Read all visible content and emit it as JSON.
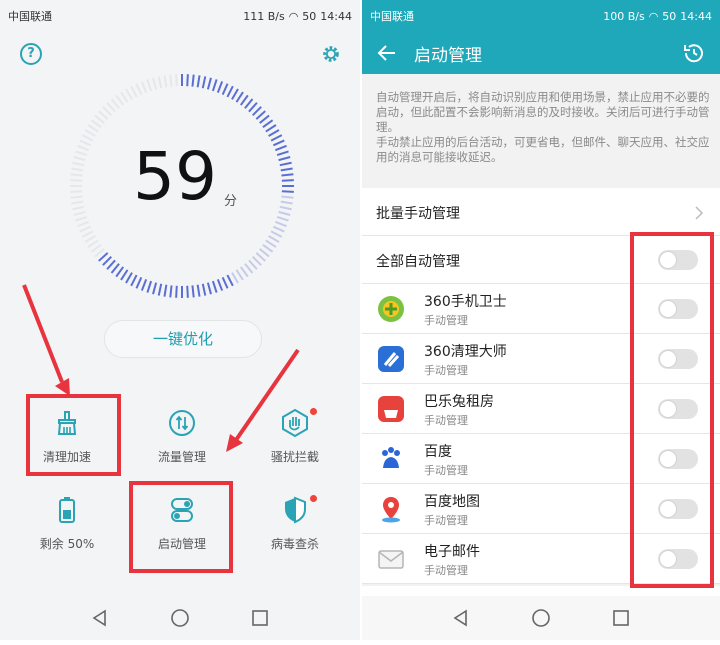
{
  "left": {
    "status": {
      "carrier": "中国联通",
      "speed": "111 B/s",
      "battery": "50",
      "time": "14:44"
    },
    "score": {
      "value": "59",
      "unit": "分"
    },
    "optimize_label": "一键优化",
    "tools": [
      {
        "label": "清理加速",
        "icon": "broom-icon"
      },
      {
        "label": "流量管理",
        "icon": "data-traffic-icon"
      },
      {
        "label": "骚扰拦截",
        "icon": "hand-block-icon",
        "badge": true
      },
      {
        "label": "剩余 50%",
        "icon": "battery-icon"
      },
      {
        "label": "启动管理",
        "icon": "startup-toggle-icon"
      },
      {
        "label": "病毒查杀",
        "icon": "shield-icon",
        "badge": true
      }
    ]
  },
  "right": {
    "status": {
      "carrier": "中国联通",
      "speed": "100 B/s",
      "battery": "50",
      "time": "14:44"
    },
    "title": "启动管理",
    "description": [
      "自动管理开启后，将自动识别应用和使用场景，禁止应用不必要的启动，但此配置不会影响新消息的及时接收。关闭后可进行手动管理。",
      "手动禁止应用的后台活动，可更省电，但邮件、聊天应用、社交应用的消息可能接收延迟。"
    ],
    "batch_label": "批量手动管理",
    "all_label": "全部自动管理",
    "apps": [
      {
        "name": "360手机卫士",
        "status": "手动管理",
        "icon": "360-security-icon"
      },
      {
        "name": "360清理大师",
        "status": "手动管理",
        "icon": "360-cleaner-icon"
      },
      {
        "name": "巴乐兔租房",
        "status": "手动管理",
        "icon": "baletu-icon"
      },
      {
        "name": "百度",
        "status": "手动管理",
        "icon": "baidu-icon"
      },
      {
        "name": "百度地图",
        "status": "手动管理",
        "icon": "baidu-map-icon"
      },
      {
        "name": "电子邮件",
        "status": "手动管理",
        "icon": "email-icon"
      }
    ],
    "toggle_state": "off"
  },
  "colors": {
    "accent": "#1fa8b9",
    "annotation": "#e7343f",
    "badge": "#f0433a"
  }
}
